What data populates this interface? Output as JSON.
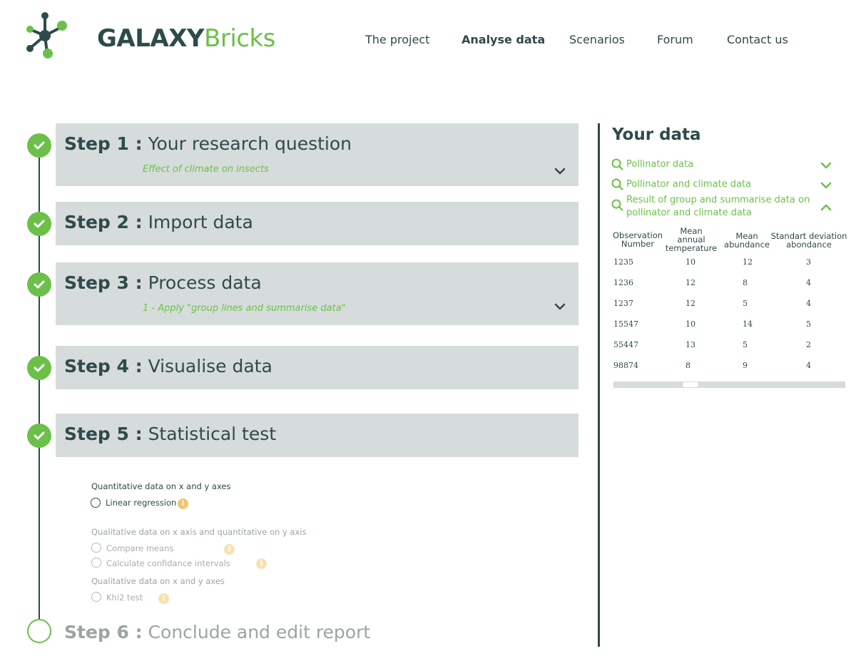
{
  "brand": {
    "name_bold": "GALAXY",
    "name_light": "Bricks"
  },
  "nav": [
    "The project",
    "Analyse data",
    "Scenarios",
    "Forum",
    "Contact us"
  ],
  "steps": [
    {
      "num": "Step 1 :",
      "title": "Your research question",
      "sub": "Effect of climate on insects",
      "status": "done"
    },
    {
      "num": "Step 2 :",
      "title": "Import data",
      "sub": "",
      "status": "done"
    },
    {
      "num": "Step 3 :",
      "title": "Process data",
      "sub": "1 - Apply \"group lines and summarise data\"",
      "status": "done"
    },
    {
      "num": "Step 4 :",
      "title": "Visualise data",
      "sub": "",
      "status": "done"
    },
    {
      "num": "Step 5 :",
      "title": "Statistical test",
      "sub": "",
      "status": "done"
    },
    {
      "num": "Step 6 :",
      "title": "Conclude and edit report",
      "sub": "",
      "status": "todo"
    }
  ],
  "stat_test": {
    "groups": [
      {
        "title": "Quantitative data on x and y axes",
        "options": [
          "Linear regression"
        ]
      },
      {
        "title": "Qualitative data on x axis and quantitative on y axis",
        "options": [
          "Compare means",
          "Calculate confidance intervals"
        ]
      },
      {
        "title": "Qualitative data on x and y axes",
        "options": [
          "Khi2 test"
        ]
      }
    ],
    "info_glyph": "i"
  },
  "your_data": {
    "title": "Your data",
    "datasets": [
      {
        "label": "Pollinator data",
        "expanded": false
      },
      {
        "label": "Pollinator and climate data",
        "expanded": false
      },
      {
        "label": "Result of group and summarise data on pollinator and climate data",
        "expanded": true
      }
    ],
    "table": {
      "headers": [
        "Observation Number",
        "Mean annual temperature",
        "Mean abundance",
        "Standart deviation abondance"
      ],
      "rows": [
        [
          "1235",
          "10",
          "12",
          "3"
        ],
        [
          "1236",
          "12",
          "8",
          "4"
        ],
        [
          "1237",
          "12",
          "5",
          "4"
        ],
        [
          "15547",
          "10",
          "14",
          "5"
        ],
        [
          "55447",
          "13",
          "5",
          "2"
        ],
        [
          "98874",
          "8",
          "9",
          "4"
        ]
      ]
    }
  },
  "colors": {
    "accent": "#6cc04a",
    "dark": "#2f4a4a",
    "panel": "#d6dcdb",
    "info": "#f5c46a"
  }
}
